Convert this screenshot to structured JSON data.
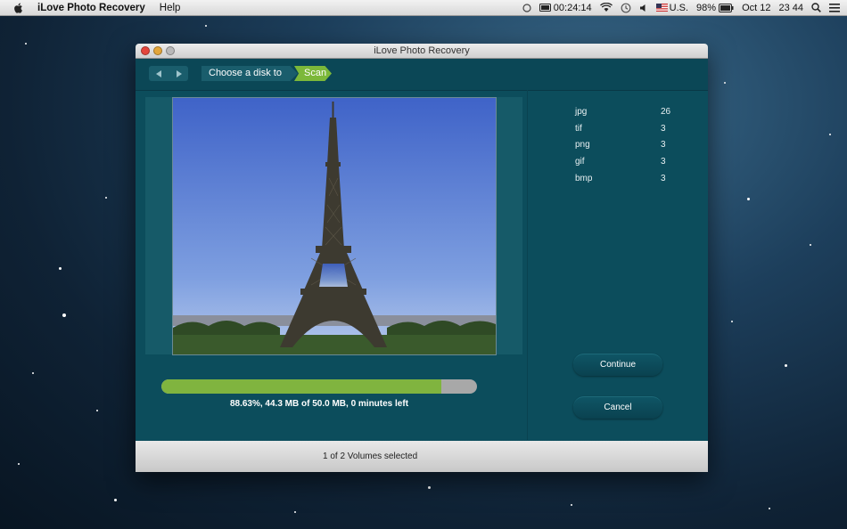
{
  "menubar": {
    "app_name": "iLove Photo Recovery",
    "menus": [
      "Help"
    ],
    "status": {
      "timer": "00:24:14",
      "input_source": "U.S.",
      "battery": "98%",
      "date": "Oct 12",
      "time": "23 44"
    }
  },
  "window": {
    "title": "iLove Photo Recovery",
    "breadcrumb": {
      "step1": "Choose a disk to start",
      "step2": "Scan"
    },
    "file_stats": [
      {
        "type": "jpg",
        "count": "26"
      },
      {
        "type": "tif",
        "count": "3"
      },
      {
        "type": "png",
        "count": "3"
      },
      {
        "type": "gif",
        "count": "3"
      },
      {
        "type": "bmp",
        "count": "3"
      }
    ],
    "progress": {
      "percent": 88.63,
      "label": "88.63%, 44.3 MB of 50.0 MB, 0 minutes left"
    },
    "buttons": {
      "continue": "Continue",
      "cancel": "Cancel"
    },
    "footer": "1 of 2 Volumes selected"
  },
  "colors": {
    "window_bg": "#0c4d5c",
    "progress_fill": "#80b43f",
    "progress_track": "#a8a8a8",
    "active_step": "#7cb83a"
  }
}
